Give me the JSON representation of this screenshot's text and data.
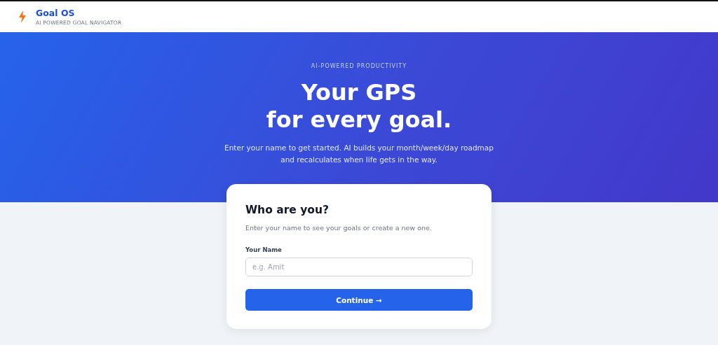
{
  "header": {
    "brand": "Goal OS",
    "tagline": "AI POWERED GOAL NAVIGATOR"
  },
  "hero": {
    "eyebrow": "AI-POWERED PRODUCTIVITY",
    "title_lines": [
      "Your GPS",
      "for every goal."
    ],
    "subtitle_lines": [
      "Enter your name to get started. AI builds your month/week/day roadmap",
      "and recalculates when life gets in the way."
    ]
  },
  "card": {
    "title": "Who are you?",
    "description": "Enter your name to see your goals or create a new one.",
    "field": {
      "label": "Your Name",
      "placeholder": "e.g. Amit"
    },
    "button": "Continue →"
  }
}
